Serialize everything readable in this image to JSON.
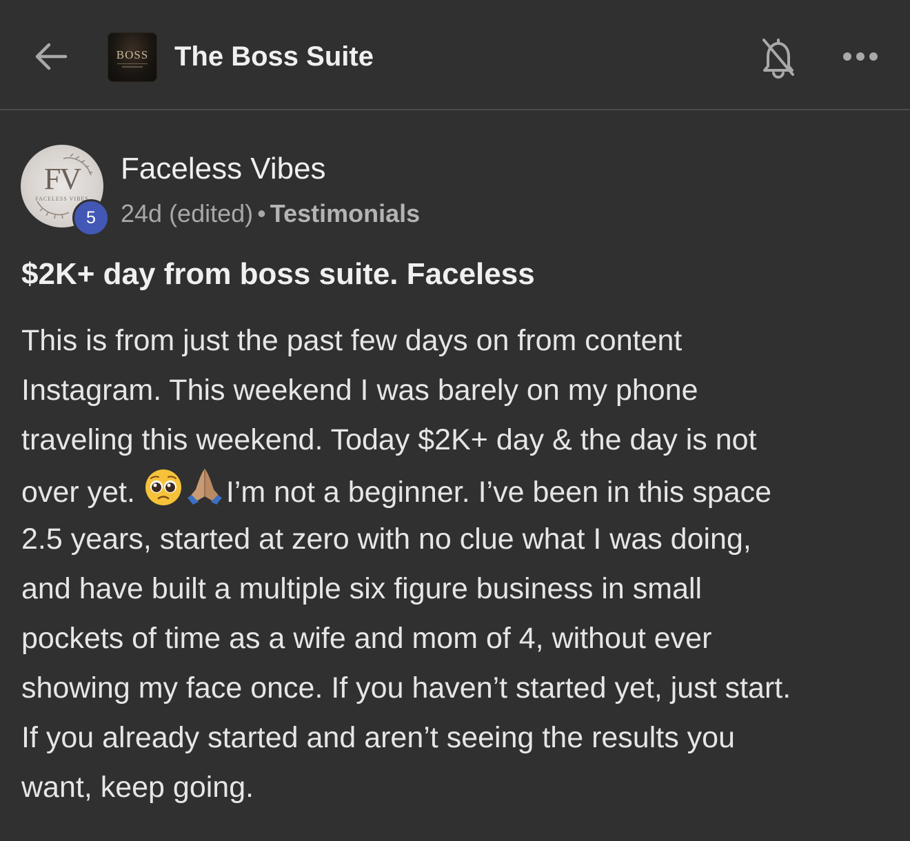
{
  "header": {
    "group_name": "The Boss Suite",
    "logo_text": "BOSS",
    "back_icon": "arrow-left-icon",
    "bell_icon": "bell-off-icon",
    "more_icon": "more-horizontal-icon"
  },
  "post": {
    "author": {
      "name": "Faceless Vibes",
      "avatar_monogram": "FV",
      "avatar_caption": "FACELESS VIBES",
      "level": "5",
      "level_badge_color": "#4357b5"
    },
    "meta": {
      "time": "24d (edited)",
      "separator": "•",
      "category": "Testimonials"
    },
    "title": "$2K+ day from boss suite. Faceless",
    "body_lines": [
      "This is from just the past few days on from content",
      "Instagram. This weekend I was barely on my phone",
      "traveling this weekend. Today $2K+ day & the day is not",
      "over yet.",
      "I’m not a beginner. I’ve been in this space",
      "2.5 years, started at zero with no clue what I was doing,",
      "and have built a multiple six figure business in small",
      "pockets of time as a wife and mom of 4, without ever",
      "showing my face once. If you haven’t started yet, just start.",
      "If you already started and aren’t seeing the results you",
      "want, keep going."
    ],
    "emojis": [
      "pleading-face-emoji",
      "folded-hands-emoji"
    ]
  },
  "colors": {
    "background": "#303030",
    "divider": "#4a4a4a",
    "text_primary": "#f0f0f0",
    "text_secondary": "#a8a8a8"
  }
}
